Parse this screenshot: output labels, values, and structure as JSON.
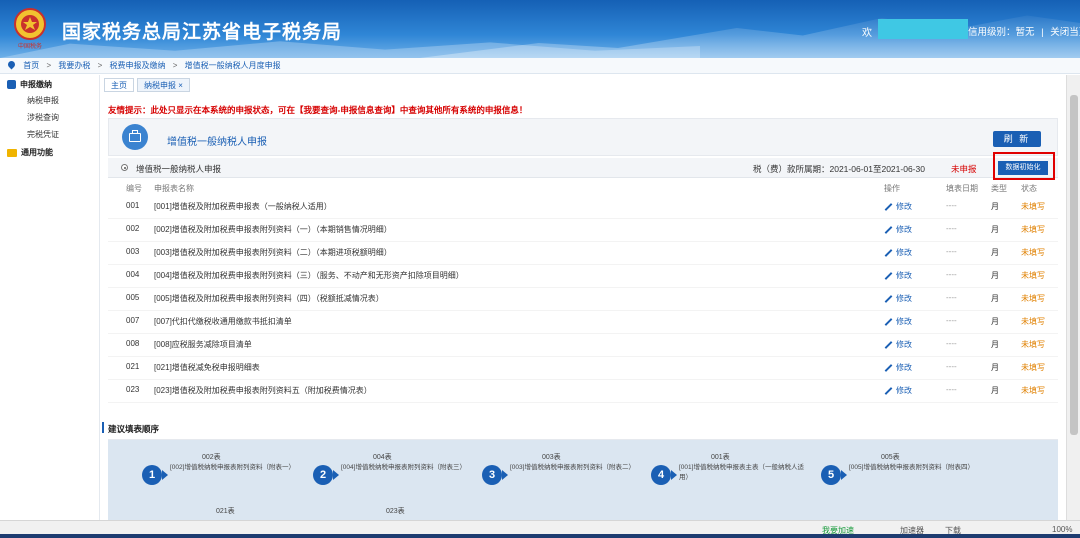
{
  "header": {
    "title": "国家税务总局江苏省电子税务局",
    "emblem_text": "中国税务",
    "welcome": "欢",
    "credit_level": "信用级别：暂无",
    "separator": "|",
    "close_page": "关闭当页"
  },
  "breadcrumb": {
    "items": [
      "首页",
      "我要办税",
      "税费申报及缴纳",
      "增值税一般纳税人月度申报"
    ],
    "sep": ">"
  },
  "sidebar": {
    "groups": [
      {
        "label": "申报缴纳",
        "items": [
          "纳税申报",
          "涉税查询",
          "完税凭证"
        ]
      },
      {
        "label": "通用功能",
        "items": []
      }
    ]
  },
  "tabs": [
    {
      "label": "主页"
    },
    {
      "label": "纳税申报 ×"
    }
  ],
  "notice": "友情提示：此处只显示在本系统的申报状态，可在【我要查询-申报信息查询】中查询其他所有系统的申报信息！",
  "form": {
    "title": "增值税一般纳税人申报",
    "refresh_label": "刷 新",
    "period_name": "增值税一般纳税人申报",
    "period_text": "税（费）款所属期：2021-06-01至2021-06-30",
    "period_status": "未申报",
    "init_label": "数据初始化"
  },
  "table": {
    "headers": {
      "no": "编号",
      "name": "申报表名称",
      "op": "操作",
      "date": "填表日期",
      "type": "类型",
      "status": "状态"
    },
    "rows": [
      {
        "no": "001",
        "name": "[001]增值税及附加税费申报表（一般纳税人适用）",
        "op": "修改",
        "date": "----",
        "type": "月",
        "status": "未填写"
      },
      {
        "no": "002",
        "name": "[002]增值税及附加税费申报表附列资料（一）（本期销售情况明细）",
        "op": "修改",
        "date": "----",
        "type": "月",
        "status": "未填写"
      },
      {
        "no": "003",
        "name": "[003]增值税及附加税费申报表附列资料（二）（本期进项税额明细）",
        "op": "修改",
        "date": "----",
        "type": "月",
        "status": "未填写"
      },
      {
        "no": "004",
        "name": "[004]增值税及附加税费申报表附列资料（三）（服务、不动产和无形资产扣除项目明细）",
        "op": "修改",
        "date": "----",
        "type": "月",
        "status": "未填写"
      },
      {
        "no": "005",
        "name": "[005]增值税及附加税费申报表附列资料（四）（税额抵减情况表）",
        "op": "修改",
        "date": "----",
        "type": "月",
        "status": "未填写"
      },
      {
        "no": "007",
        "name": "[007]代扣代缴税收通用缴款书抵扣清单",
        "op": "修改",
        "date": "----",
        "type": "月",
        "status": "未填写"
      },
      {
        "no": "008",
        "name": "[008]应税服务减除项目清单",
        "op": "修改",
        "date": "----",
        "type": "月",
        "status": "未填写"
      },
      {
        "no": "021",
        "name": "[021]增值税减免税申报明细表",
        "op": "修改",
        "date": "----",
        "type": "月",
        "status": "未填写"
      },
      {
        "no": "023",
        "name": "[023]增值税及附加税费申报表附列资料五（附加税费情况表）",
        "op": "修改",
        "date": "----",
        "type": "月",
        "status": "未填写"
      }
    ]
  },
  "suggest": {
    "title": "建议填表顺序",
    "steps": [
      {
        "num": "1",
        "code": "002表",
        "desc": "[002]增值税纳税申报表附列资料（附表一）"
      },
      {
        "num": "2",
        "code": "004表",
        "desc": "[004]增值税纳税申报表附列资料（附表三）"
      },
      {
        "num": "3",
        "code": "003表",
        "desc": "[003]增值税纳税申报表附列资料（附表二）"
      },
      {
        "num": "4",
        "code": "001表",
        "desc": "[001]增值税纳税申报表主表（一般纳税人适用）"
      },
      {
        "num": "5",
        "code": "005表",
        "desc": "[005]增值税纳税申报表附列资料（附表四）"
      }
    ],
    "next_codes": [
      "021表",
      "023表"
    ]
  },
  "statusbar": {
    "items": [
      "我要加速",
      "加速器",
      "下载",
      "100%"
    ]
  }
}
